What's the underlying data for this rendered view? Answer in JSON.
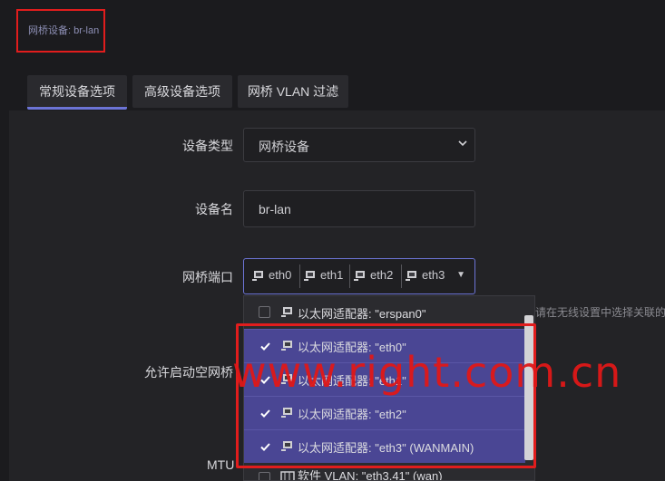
{
  "title": "网桥设备: br-lan",
  "tabs": [
    "常规设备选项",
    "高级设备选项",
    "网桥 VLAN 过滤"
  ],
  "form": {
    "device_type_label": "设备类型",
    "device_type_value": "网桥设备",
    "device_name_label": "设备名",
    "device_name_value": "br-lan",
    "bridge_ports_label": "网桥端口",
    "bridge_ports": [
      "eth0",
      "eth1",
      "eth2",
      "eth3"
    ],
    "allow_empty_label": "允许启动空网桥",
    "mtu_label": "MTU",
    "hint": "请在无线设置中选择关联的"
  },
  "dropdown": {
    "options": [
      {
        "label": "以太网适配器: \"erspan0\"",
        "checked": false
      },
      {
        "label": "以太网适配器: \"eth0\"",
        "checked": true
      },
      {
        "label": "以太网适配器: \"eth1\"",
        "checked": true
      },
      {
        "label": "以太网适配器: \"eth2\"",
        "checked": true
      },
      {
        "label": "以太网适配器: \"eth3\" (WANMAIN)",
        "checked": true
      },
      {
        "label": "软件 VLAN: \"eth3.41\" (wan)",
        "checked": false
      }
    ]
  },
  "watermark": "www.right.com.cn",
  "colors": {
    "accent": "#6c74d6",
    "selected": "#4a4694",
    "highlight": "#e11d1d"
  }
}
